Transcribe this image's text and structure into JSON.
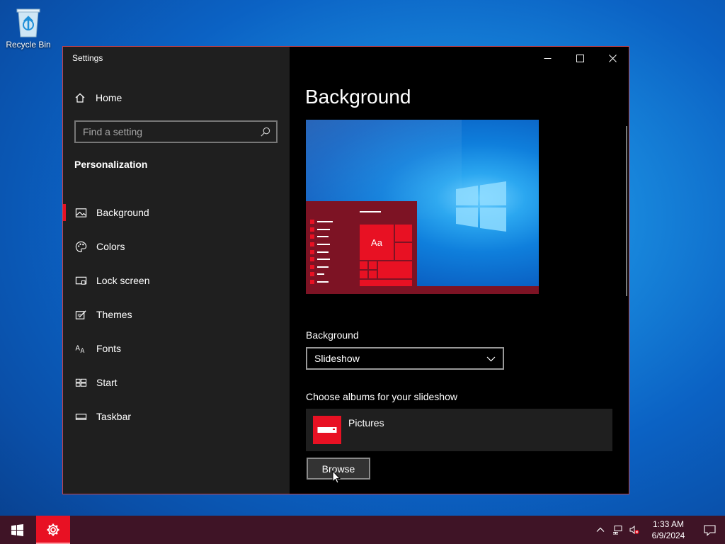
{
  "desktop": {
    "icons": [
      {
        "label": "Recycle Bin",
        "icon": "recycle-bin-icon"
      }
    ]
  },
  "window": {
    "title": "Settings",
    "caption_buttons": [
      "minimize",
      "maximize",
      "close"
    ]
  },
  "sidebar": {
    "home_label": "Home",
    "search_placeholder": "Find a setting",
    "section_title": "Personalization",
    "items": [
      {
        "label": "Background",
        "icon": "picture-icon",
        "active": true
      },
      {
        "label": "Colors",
        "icon": "palette-icon",
        "active": false
      },
      {
        "label": "Lock screen",
        "icon": "lock-screen-icon",
        "active": false
      },
      {
        "label": "Themes",
        "icon": "themes-icon",
        "active": false
      },
      {
        "label": "Fonts",
        "icon": "fonts-icon",
        "active": false
      },
      {
        "label": "Start",
        "icon": "start-icon",
        "active": false
      },
      {
        "label": "Taskbar",
        "icon": "taskbar-icon",
        "active": false
      }
    ]
  },
  "content": {
    "page_title": "Background",
    "preview": {
      "tile_label": "Aa"
    },
    "background_label": "Background",
    "background_value": "Slideshow",
    "albums_label": "Choose albums for your slideshow",
    "album_name": "Pictures",
    "browse_label": "Browse"
  },
  "taskbar": {
    "time": "1:33 AM",
    "date": "6/9/2024",
    "accent_color": "#e81123",
    "background_color": "#3f1426"
  },
  "colors": {
    "accent": "#e81123",
    "sidebar_bg": "#1f1f1f",
    "content_bg": "#000000"
  }
}
